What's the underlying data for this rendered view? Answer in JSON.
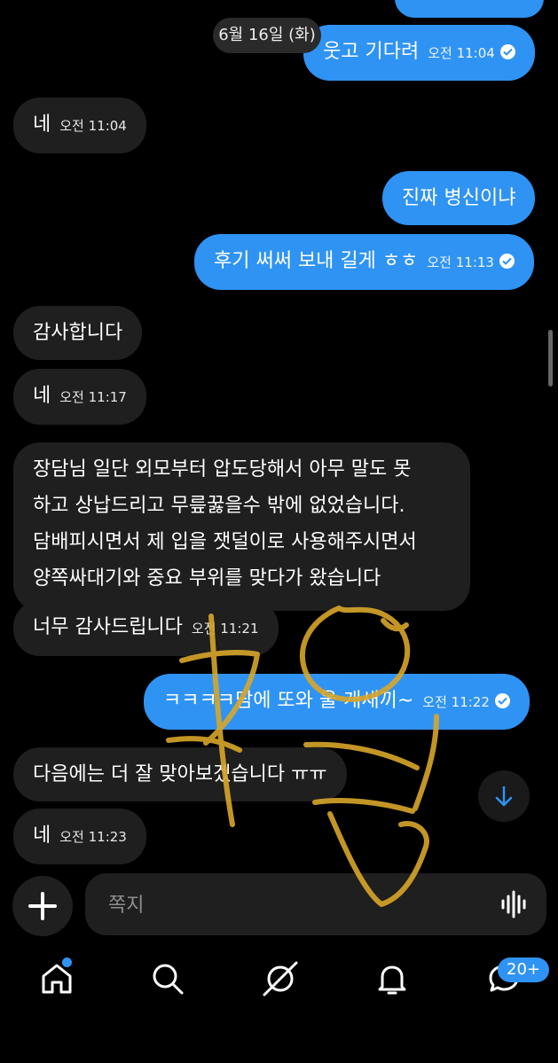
{
  "date_chip": "6월 16일 (화)",
  "messages": [
    {
      "side": "sent",
      "text": "웃고 기다려",
      "time": "오전 11:04"
    },
    {
      "side": "recv",
      "text": "네",
      "time": "오전 11:04"
    },
    {
      "side": "sent",
      "text": "진짜 병신이냐",
      "time": ""
    },
    {
      "side": "sent",
      "text": "후기 써써 보내 길게 ㅎㅎ",
      "time": "오전 11:13"
    },
    {
      "side": "recv",
      "text": "감사합니다",
      "time": ""
    },
    {
      "side": "recv",
      "text": "네",
      "time": "오전 11:17"
    },
    {
      "side": "recv",
      "lines": [
        "장담님 일단 외모부터 압도당해서 아무 말도 못",
        "하고 상납드리고 무릎꿇을수 밖에 없었습니다.",
        "담배피시면서 제 입을 잿덜이로 사용해주시면서",
        "양쪽싸대기와 중요 부위를 맞다가 왔습니다"
      ],
      "time": ""
    },
    {
      "side": "recv",
      "text": "너무 감사드립니다",
      "time": "오전 11:21"
    },
    {
      "side": "sent",
      "text": "ㅋㅋㅋㅋ담에 또와 울 개새끼~",
      "time": "오전 11:22"
    },
    {
      "side": "recv",
      "text": "다음에는 더 잘 맞아보겠습니다 ㅠㅠ",
      "time": ""
    },
    {
      "side": "recv",
      "text": "네",
      "time": "오전 11:23"
    }
  ],
  "composer": {
    "placeholder": "쪽지"
  },
  "nav": {
    "badge": "20+",
    "icons": [
      "home-icon",
      "search-icon",
      "explore-icon",
      "bell-icon",
      "messages-icon"
    ]
  },
  "colors": {
    "sent_bubble": "#2f93f3",
    "recv_bubble": "#1f1f1f",
    "background": "#000000",
    "scribble": "#d8a62a"
  },
  "overlay": {
    "scribble": "handwritten yellow mark"
  }
}
